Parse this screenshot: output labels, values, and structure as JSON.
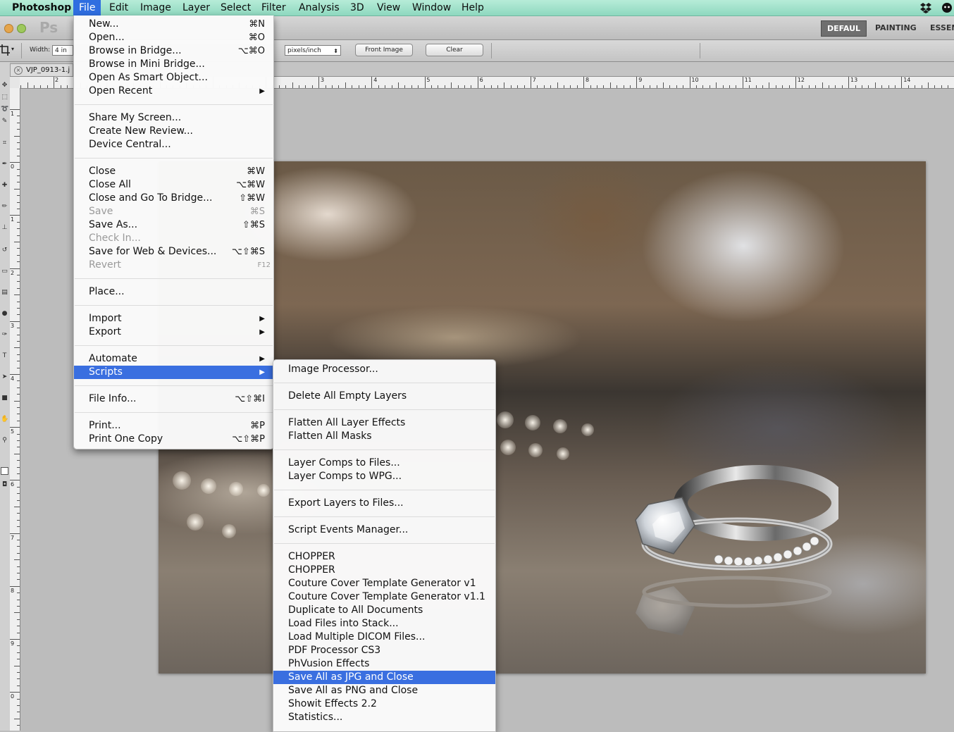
{
  "menubar": {
    "app": "Photoshop",
    "items": [
      "File",
      "Edit",
      "Image",
      "Layer",
      "Select",
      "Filter",
      "Analysis",
      "3D",
      "View",
      "Window",
      "Help"
    ]
  },
  "appbar": {
    "logo": "Ps",
    "workspaces": [
      "DEFAUL",
      "PAINTING",
      "ESSEN"
    ]
  },
  "options": {
    "width_label": "Width:",
    "width_value": "4 in",
    "resolution_unit": "pixels/inch",
    "front_image": "Front Image",
    "clear": "Clear"
  },
  "document": {
    "tab_title": "VJP_0913-1.j",
    "close_glyph": "×"
  },
  "ruler": {
    "h_labels": [
      "2",
      "3",
      "4",
      "5",
      "6",
      "7",
      "8",
      "9",
      "10",
      "11",
      "12",
      "13",
      "14"
    ],
    "v_labels": [
      "1",
      "0",
      "1",
      "2",
      "3",
      "4",
      "5",
      "6",
      "7",
      "8",
      "9",
      "0"
    ]
  },
  "file_menu": {
    "items": [
      {
        "label": "New...",
        "shortcut": "⌘N"
      },
      {
        "label": "Open...",
        "shortcut": "⌘O"
      },
      {
        "label": "Browse in Bridge...",
        "shortcut": "⌥⌘O"
      },
      {
        "label": "Browse in Mini Bridge...",
        "shortcut": ""
      },
      {
        "label": "Open As Smart Object...",
        "shortcut": ""
      },
      {
        "label": "Open Recent",
        "shortcut": "",
        "submenu": true
      },
      {
        "label": "Share My Screen...",
        "shortcut": ""
      },
      {
        "label": "Create New Review...",
        "shortcut": ""
      },
      {
        "label": "Device Central...",
        "shortcut": ""
      },
      {
        "label": "Close",
        "shortcut": "⌘W"
      },
      {
        "label": "Close All",
        "shortcut": "⌥⌘W"
      },
      {
        "label": "Close and Go To Bridge...",
        "shortcut": "⇧⌘W"
      },
      {
        "label": "Save",
        "shortcut": "⌘S",
        "disabled": true
      },
      {
        "label": "Save As...",
        "shortcut": "⇧⌘S"
      },
      {
        "label": "Check In...",
        "shortcut": "",
        "disabled": true
      },
      {
        "label": "Save for Web & Devices...",
        "shortcut": "⌥⇧⌘S"
      },
      {
        "label": "Revert",
        "shortcut": "F12",
        "disabled": true
      },
      {
        "label": "Place...",
        "shortcut": ""
      },
      {
        "label": "Import",
        "shortcut": "",
        "submenu": true
      },
      {
        "label": "Export",
        "shortcut": "",
        "submenu": true
      },
      {
        "label": "Automate",
        "shortcut": "",
        "submenu": true
      },
      {
        "label": "Scripts",
        "shortcut": "",
        "submenu": true,
        "highlight": true
      },
      {
        "label": "File Info...",
        "shortcut": "⌥⇧⌘I"
      },
      {
        "label": "Print...",
        "shortcut": "⌘P"
      },
      {
        "label": "Print One Copy",
        "shortcut": "⌥⇧⌘P"
      }
    ]
  },
  "scripts_menu": {
    "items": [
      {
        "label": "Image Processor..."
      },
      {
        "label": "Delete All Empty Layers"
      },
      {
        "label": "Flatten All Layer Effects"
      },
      {
        "label": "Flatten All Masks"
      },
      {
        "label": "Layer Comps to Files..."
      },
      {
        "label": "Layer Comps to WPG..."
      },
      {
        "label": "Export Layers to Files..."
      },
      {
        "label": "Script Events Manager..."
      },
      {
        "label": "CHOPPER"
      },
      {
        "label": "CHOPPER"
      },
      {
        "label": "Couture Cover Template Generator v1"
      },
      {
        "label": "Couture Cover Template Generator v1.1"
      },
      {
        "label": "Duplicate to All Documents"
      },
      {
        "label": "Load Files into Stack..."
      },
      {
        "label": "Load Multiple DICOM Files..."
      },
      {
        "label": "PDF Processor CS3"
      },
      {
        "label": "PhVusion Effects"
      },
      {
        "label": "Save All as JPG and Close",
        "highlight": true
      },
      {
        "label": "Save All as PNG and Close"
      },
      {
        "label": "Showit Effects 2.2"
      },
      {
        "label": "Statistics..."
      }
    ]
  },
  "colors": {
    "menubar": "#9fe0c9",
    "highlight": "#3a6fe0"
  }
}
